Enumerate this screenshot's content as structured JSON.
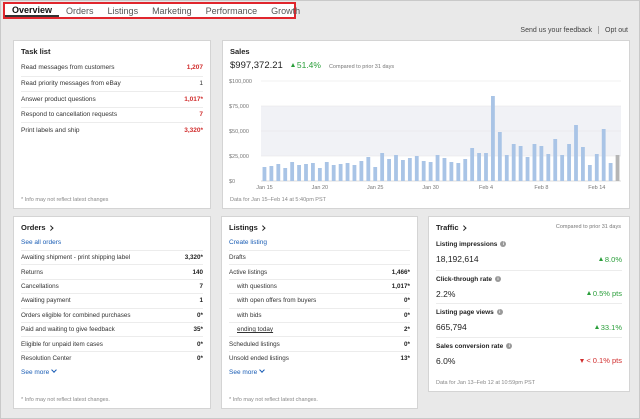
{
  "nav": {
    "tabs": [
      {
        "label": "Overview"
      },
      {
        "label": "Orders"
      },
      {
        "label": "Listings"
      },
      {
        "label": "Marketing"
      },
      {
        "label": "Performance"
      },
      {
        "label": "Growth"
      }
    ],
    "active_tab": "Overview"
  },
  "toplinks": {
    "feedback": "Send us your feedback",
    "opt_out": "Opt out"
  },
  "colors": {
    "accent_red": "#e0262d",
    "link_blue": "#1a5db5",
    "positive_green": "#2a9e3a",
    "negative_red": "#d12d2d",
    "bar_blue": "#a9c4e6",
    "bar_gray": "#b5b5b5"
  },
  "tasks": {
    "title": "Task list",
    "items": [
      {
        "label": "Read messages from customers",
        "value": "1,207",
        "highlight": true
      },
      {
        "label": "Read priority messages from eBay",
        "value": "1",
        "highlight": false
      },
      {
        "label": "Answer product questions",
        "value": "1,017*",
        "highlight": true
      },
      {
        "label": "Respond to cancellation requests",
        "value": "7",
        "highlight": true
      },
      {
        "label": "Print labels and ship",
        "value": "3,320*",
        "highlight": true
      }
    ],
    "footnote": "* Info may not reflect latest changes"
  },
  "sales": {
    "title": "Sales",
    "total": "$997,372.21",
    "change": "51.4%",
    "compare": "Compared to prior 31 days",
    "footnote": "Data for Jan 15–Feb 14 at 5:40pm PST"
  },
  "chart_data": {
    "type": "bar",
    "categories": [
      "Jan 15",
      "",
      "",
      "",
      "",
      "",
      "",
      "",
      "Jan 20",
      "",
      "",
      "",
      "",
      "",
      "",
      "",
      "Jan 25",
      "",
      "",
      "",
      "",
      "",
      "",
      "",
      "Jan 30",
      "",
      "",
      "",
      "",
      "",
      "",
      "",
      "Feb 4",
      "",
      "",
      "",
      "",
      "",
      "",
      "",
      "Feb 8",
      "",
      "",
      "",
      "",
      "",
      "",
      "",
      "Feb 14"
    ],
    "x_tick_labels": [
      "Jan 15",
      "Jan 20",
      "Jan 25",
      "Jan 30",
      "Feb 4",
      "Feb 8",
      "Feb 14"
    ],
    "values": [
      14,
      15,
      17,
      13,
      19,
      16,
      17,
      18,
      13,
      19,
      16,
      17,
      18,
      16,
      20,
      24,
      14,
      28,
      22,
      26,
      21,
      23,
      25,
      20,
      19,
      26,
      23,
      19,
      18,
      22,
      33,
      28,
      28,
      85,
      49,
      26,
      37,
      35,
      24,
      37,
      35,
      27,
      42,
      26,
      37,
      56,
      34,
      16,
      27,
      52,
      18,
      26
    ],
    "y_tick_labels": [
      "$0",
      "$25,000",
      "$50,000",
      "$75,000",
      "$100,000"
    ],
    "ylim": [
      0,
      100000
    ],
    "units": "thousands of dollars per day (values in $K)",
    "grid": true
  },
  "orders": {
    "title": "Orders",
    "see_all": "See all orders",
    "items": [
      {
        "label": "Awaiting shipment - print shipping label",
        "value": "3,320*"
      },
      {
        "label": "Returns",
        "value": "140"
      },
      {
        "label": "Cancellations",
        "value": "7"
      },
      {
        "label": "Awaiting payment",
        "value": "1"
      },
      {
        "label": "Orders eligible for combined purchases",
        "value": "0*"
      },
      {
        "label": "Paid and waiting to give feedback",
        "value": "35*"
      },
      {
        "label": "Eligible for unpaid item cases",
        "value": "0*"
      },
      {
        "label": "Resolution Center",
        "value": "0*"
      }
    ],
    "see_more": "See more",
    "footnote": "* Info may not reflect latest changes."
  },
  "listings": {
    "title": "Listings",
    "create": "Create listing",
    "items": [
      {
        "label": "Drafts",
        "value": "",
        "indent": false,
        "underline": false
      },
      {
        "label": "Active listings",
        "value": "1,466*",
        "indent": false,
        "underline": false
      },
      {
        "label": "with questions",
        "value": "1,017*",
        "indent": true,
        "underline": false
      },
      {
        "label": "with open offers from buyers",
        "value": "0*",
        "indent": true,
        "underline": false
      },
      {
        "label": "with bids",
        "value": "0*",
        "indent": true,
        "underline": false
      },
      {
        "label": "ending today",
        "value": "2*",
        "indent": true,
        "underline": true
      },
      {
        "label": "Scheduled listings",
        "value": "0*",
        "indent": false,
        "underline": false
      },
      {
        "label": "Unsold ended listings",
        "value": "13*",
        "indent": false,
        "underline": false
      }
    ],
    "see_more": "See more",
    "footnote": "* Info may not reflect latest changes."
  },
  "traffic": {
    "title": "Traffic",
    "compare": "Compared to prior 31 days",
    "metrics": [
      {
        "label": "Listing impressions",
        "value": "18,192,614",
        "change": "8.0%",
        "direction": "up"
      },
      {
        "label": "Click-through rate",
        "value": "2.2%",
        "change": "0.5% pts",
        "direction": "up"
      },
      {
        "label": "Listing page views",
        "value": "665,794",
        "change": "33.1%",
        "direction": "up"
      },
      {
        "label": "Sales conversion rate",
        "value": "6.0%",
        "change": "< 0.1% pts",
        "direction": "down"
      }
    ],
    "footnote": "Data for Jan 13–Feb 12 at 10:59pm PST"
  }
}
